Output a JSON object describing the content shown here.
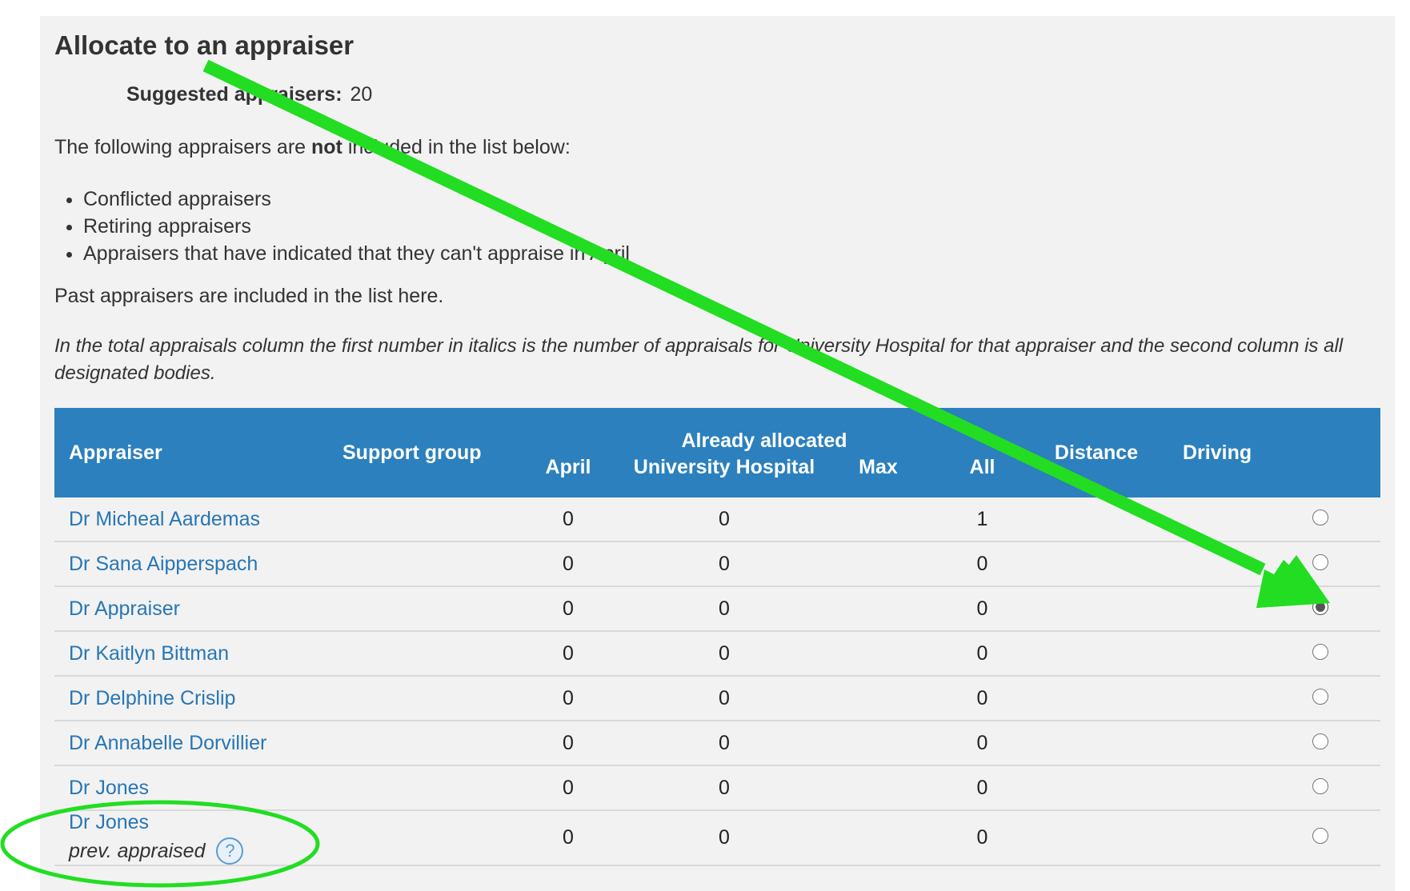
{
  "panel": {
    "title": "Allocate to an appraiser",
    "suggested_label": "Suggested appraisers:",
    "suggested_value": "20",
    "intro_prefix": "The following appraisers are ",
    "intro_emphasis": "not",
    "intro_suffix": " included in the list below:",
    "exclusions": [
      "Conflicted appraisers",
      "Retiring appraisers",
      "Appraisers that have indicated that they can't appraise in April"
    ],
    "past_note": "Past appraisers are included in the list here.",
    "italic_note": "In the total appraisals column the first number in italics is the number of appraisals for University Hospital for that appraiser and the second column is all designated bodies."
  },
  "table": {
    "headers": {
      "appraiser": "Appraiser",
      "support_group": "Support group",
      "already_allocated": "Already allocated",
      "april": "April",
      "university_hospital": "University Hospital",
      "max": "Max",
      "all": "All",
      "distance": "Distance",
      "driving": "Driving"
    },
    "rows": [
      {
        "name": "Dr Micheal Aardemas",
        "april": "0",
        "university_hospital": "0",
        "all": "1",
        "selected": false
      },
      {
        "name": "Dr Sana Aipperspach",
        "april": "0",
        "university_hospital": "0",
        "all": "0",
        "selected": false
      },
      {
        "name": "Dr Appraiser",
        "april": "0",
        "university_hospital": "0",
        "all": "0",
        "selected": true
      },
      {
        "name": "Dr Kaitlyn Bittman",
        "april": "0",
        "university_hospital": "0",
        "all": "0",
        "selected": false
      },
      {
        "name": "Dr Delphine Crislip",
        "april": "0",
        "university_hospital": "0",
        "all": "0",
        "selected": false
      },
      {
        "name": "Dr Annabelle Dorvillier",
        "april": "0",
        "university_hospital": "0",
        "all": "0",
        "selected": false
      },
      {
        "name": "Dr Jones",
        "april": "0",
        "university_hospital": "0",
        "all": "0",
        "selected": false
      },
      {
        "name": "Dr Jones",
        "subtitle": "prev. appraised",
        "help_icon": "?",
        "april": "0",
        "university_hospital": "0",
        "all": "0",
        "selected": false
      }
    ]
  },
  "annotations": {
    "arrow_color": "#22dd22",
    "ellipse_color": "#22dd22"
  },
  "colors": {
    "header_bg": "#2b80bd",
    "link": "#2776b5",
    "panel_bg": "#f2f2f2"
  }
}
